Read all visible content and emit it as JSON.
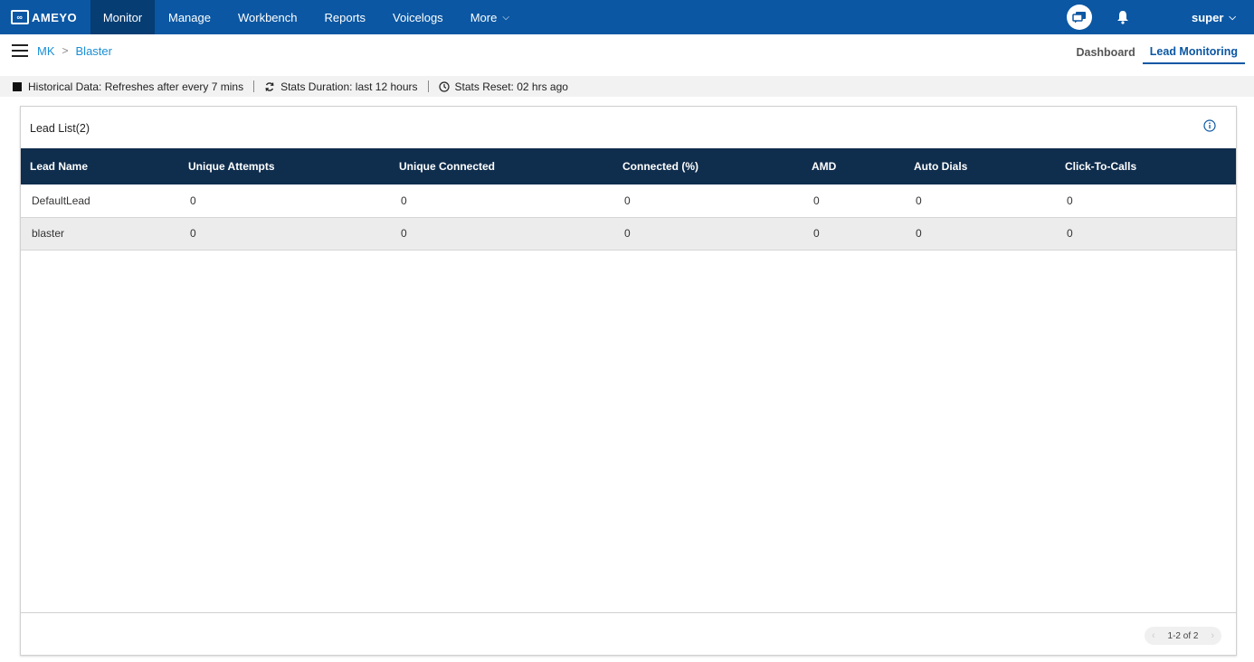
{
  "topbar": {
    "logo_text": "AMEYO",
    "nav": [
      {
        "label": "Monitor",
        "active": true
      },
      {
        "label": "Manage"
      },
      {
        "label": "Workbench"
      },
      {
        "label": "Reports"
      },
      {
        "label": "Voicelogs"
      },
      {
        "label": "More"
      }
    ],
    "user": "super"
  },
  "breadcrumb": [
    "MK",
    "Blaster"
  ],
  "tabs": [
    {
      "label": "Dashboard"
    },
    {
      "label": "Lead Monitoring",
      "active": true
    }
  ],
  "stats": {
    "historical": "Historical Data: Refreshes after every 7 mins",
    "duration": "Stats Duration: last 12 hours",
    "reset": "Stats Reset: 02 hrs ago"
  },
  "card": {
    "title": "Lead List(2)",
    "columns": [
      "Lead Name",
      "Unique Attempts",
      "Unique Connected",
      "Connected (%)",
      "AMD",
      "Auto Dials",
      "Click-To-Calls"
    ],
    "rows": [
      [
        "DefaultLead",
        "0",
        "0",
        "0",
        "0",
        "0",
        "0"
      ],
      [
        "blaster",
        "0",
        "0",
        "0",
        "0",
        "0",
        "0"
      ]
    ],
    "pagination": "1-2 of 2"
  },
  "colors": {
    "brand": "#0b57a3",
    "table_header": "#0f2d4d",
    "link": "#1a8fd6"
  }
}
